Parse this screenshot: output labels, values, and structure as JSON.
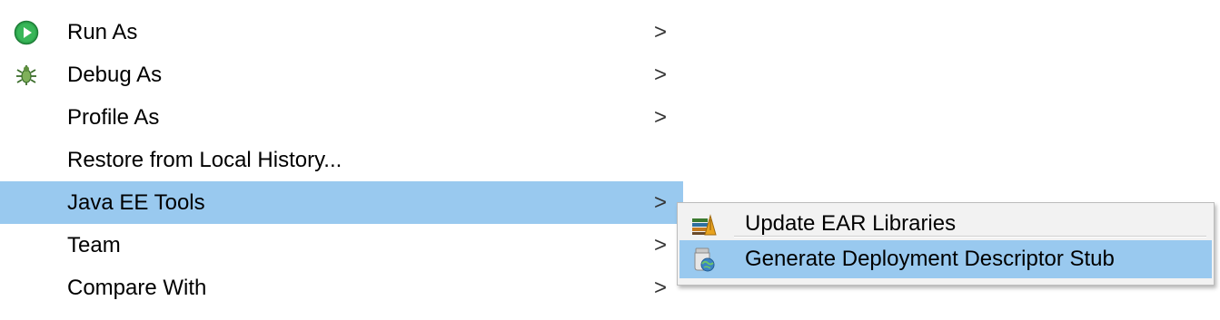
{
  "context_menu": {
    "items": [
      {
        "label": "Run As",
        "icon": "run-icon",
        "submenu_arrow": ">"
      },
      {
        "label": "Debug As",
        "icon": "debug-bug-icon",
        "submenu_arrow": ">"
      },
      {
        "label": "Profile As",
        "submenu_arrow": ">"
      },
      {
        "label": "Restore from Local History..."
      },
      {
        "label": "Java EE Tools",
        "submenu_arrow": ">",
        "highlighted": true
      },
      {
        "label": "Team",
        "submenu_arrow": ">"
      },
      {
        "label": "Compare With",
        "submenu_arrow": ">"
      }
    ]
  },
  "submenu": {
    "items": [
      {
        "label": "Update EAR Libraries",
        "icon": "ear-libraries-icon"
      },
      {
        "label": "Generate Deployment Descriptor Stub",
        "icon": "deployment-descriptor-icon",
        "highlighted": true
      }
    ]
  },
  "colors": {
    "highlight": "#99c9ef",
    "run_icon_green": "#2fa84f",
    "submenu_background": "#f2f2f2"
  }
}
